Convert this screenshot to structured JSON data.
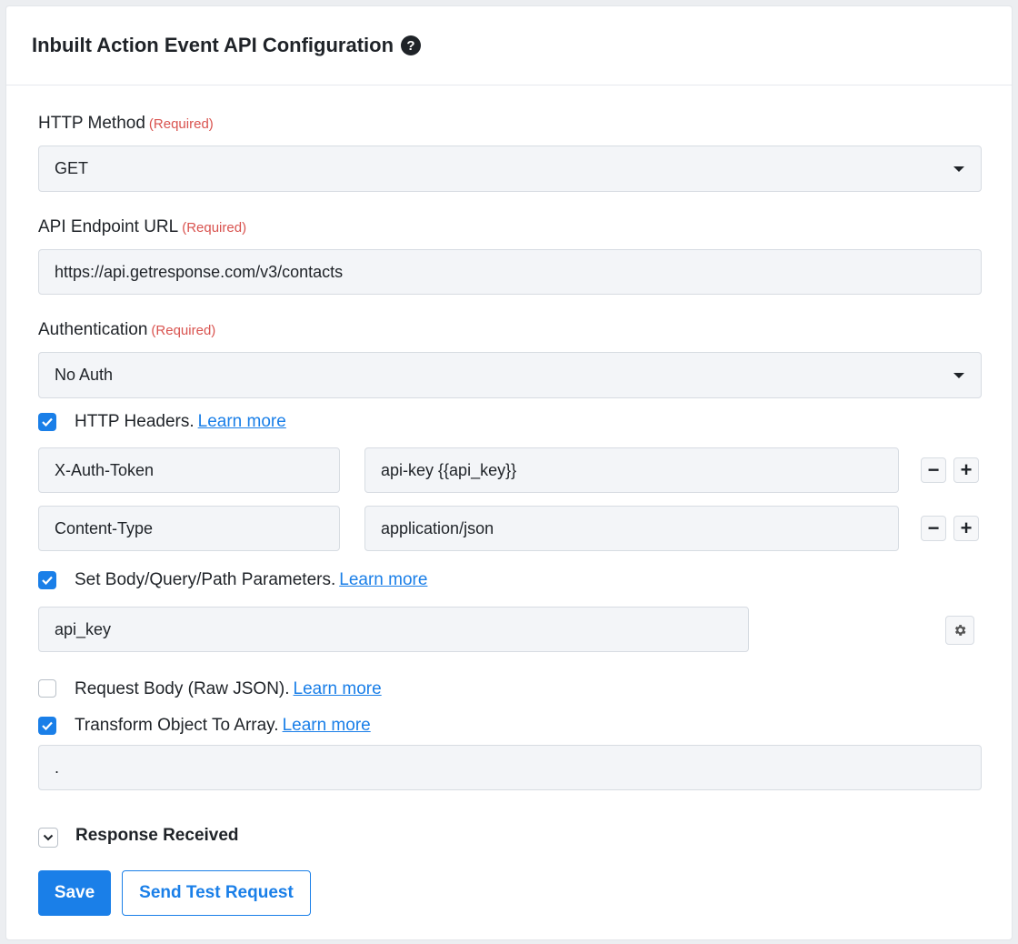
{
  "header": {
    "title": "Inbuilt Action Event API Configuration",
    "help_icon": "question-circle-icon"
  },
  "required_text": "(Required)",
  "http_method": {
    "label": "HTTP Method",
    "value": "GET"
  },
  "endpoint": {
    "label": "API Endpoint URL",
    "value": "https://api.getresponse.com/v3/contacts"
  },
  "auth": {
    "label": "Authentication",
    "value": "No Auth"
  },
  "headers_section": {
    "checked": true,
    "label": "HTTP Headers.",
    "link": "Learn more",
    "rows": [
      {
        "key": "X-Auth-Token",
        "value": "api-key {{api_key}}"
      },
      {
        "key": "Content-Type",
        "value": "application/json"
      }
    ]
  },
  "params_section": {
    "checked": true,
    "label": "Set Body/Query/Path Parameters.",
    "link": "Learn more",
    "value": "api_key"
  },
  "raw_body_section": {
    "checked": false,
    "label": "Request Body (Raw JSON).",
    "link": "Learn more"
  },
  "transform_section": {
    "checked": true,
    "label": "Transform Object To Array.",
    "link": "Learn more",
    "value": "."
  },
  "response": {
    "label": "Response Received"
  },
  "buttons": {
    "save": "Save",
    "test": "Send Test Request"
  },
  "colors": {
    "accent": "#1a7fe8",
    "required": "#d9534f",
    "field_bg": "#f3f5f8"
  }
}
